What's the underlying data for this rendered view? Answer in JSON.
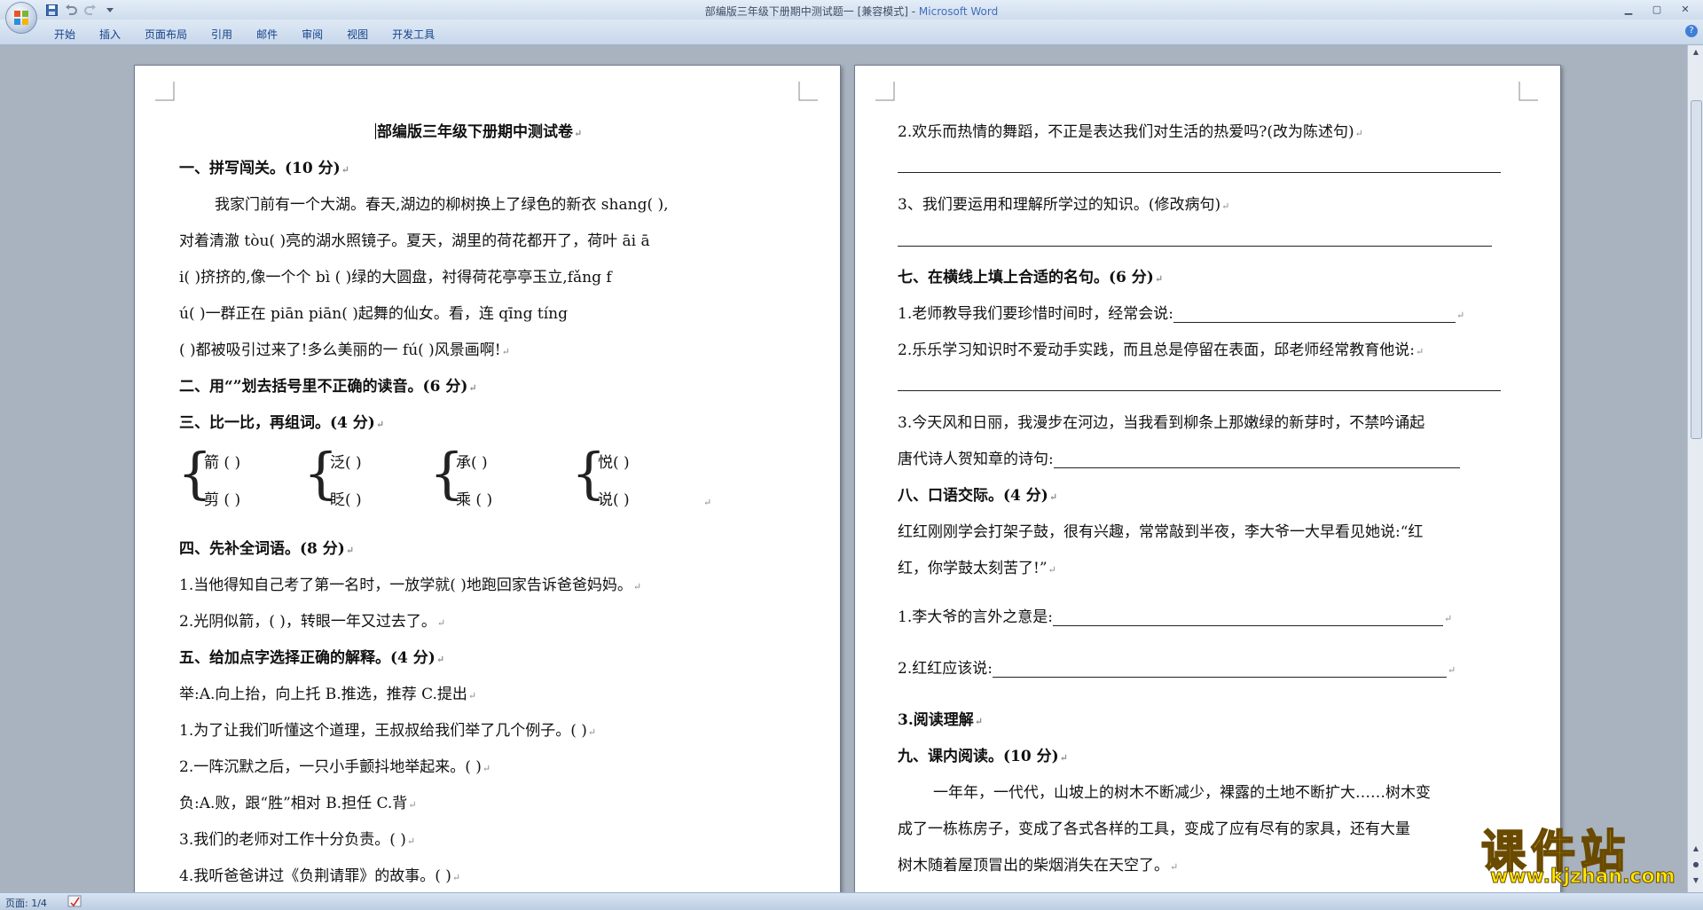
{
  "window": {
    "title_doc": "部编版三年级下册期中测试题一 [兼容模式] - ",
    "title_app": "Microsoft Word"
  },
  "ribbon": {
    "tabs": [
      "开始",
      "插入",
      "页面布局",
      "引用",
      "邮件",
      "审阅",
      "视图",
      "开发工具"
    ]
  },
  "status": {
    "page_label": "页面: 1/4"
  },
  "page1": {
    "doc_title": "部编版三年级下册期中测试卷",
    "s1_heading": "一、拼写闯关。(10 分)",
    "s1_p1": "我家门前有一个大湖。春天,湖边的柳树换上了绿色的新衣 shang(        ),",
    "s1_p2": "对着清澈 tòu(        )亮的湖水照镜子。夏天，湖里的荷花都开了，荷叶 āi  ā",
    "s1_p3": "i(      )挤挤的,像一个个 bì (       )绿的大圆盘，衬得荷花亭亭玉立,fǎng  f",
    "s1_p4": "ú(        )一群正在 piān piān(          )起舞的仙女。看，连 qīng tíng",
    "s1_p5": "(         )都被吸引过来了!多么美丽的一 fú(          )风景画啊!",
    "s2_heading": "二、用“”划去括号里不正确的读音。(6 分)",
    "s3_heading": "三、比一比，再组词。(4 分)",
    "s3_pairs": [
      {
        "top": "箭 (        )",
        "bottom": "剪 (        )"
      },
      {
        "top": "泛(         )",
        "bottom": "眨(         )"
      },
      {
        "top": "承(          )",
        "bottom": "乘 (          )"
      },
      {
        "top": "悦(         )",
        "bottom": "说(         )"
      }
    ],
    "s4_heading": "四、先补全词语。(8 分)",
    "s4_q1": "1.当他得知自己考了第一名时，一放学就(          )地跑回家告诉爸爸妈妈。",
    "s4_q2": "2.光阴似箭，(          )，转眼一年又过去了。",
    "s5_heading": "五、给加点字选择正确的解释。(4 分)",
    "s5_opt1": "举:A.向上抬，向上托 B.推选，推荐 C.提出",
    "s5_q1": "1.为了让我们听懂这个道理，王叔叔给我们举了几个例子。(          )",
    "s5_q2": "2.一阵沉默之后，一只小手颤抖地举起来。(           )",
    "s5_opt2": "负:A.败，跟“胜”相对 B.担任 C.背",
    "s5_q3": "3.我们的老师对工作十分负责。(          )",
    "s5_q4": "4.我听爸爸讲过《负荆请罪》的故事。(          )"
  },
  "page2": {
    "s6_q2": "2.欢乐而热情的舞蹈，不正是表达我们对生活的热爱吗?(改为陈述句)",
    "s6_q3": "3、我们要运用和理解所学过的知识。(修改病句)",
    "s7_heading": "七、在横线上填上合适的名句。(6 分)",
    "s7_q1": "1.老师教导我们要珍惜时间时，经常会说:",
    "s7_q2": "2.乐乐学习知识时不爱动手实践，而且总是停留在表面，邱老师经常教育他说:",
    "s7_q3a": "3.今天风和日丽，我漫步在河边，当我看到柳条上那嫩绿的新芽时，不禁吟诵起",
    "s7_q3b": "唐代诗人贺知章的诗句:",
    "s8_heading": "八、口语交际。(4 分)",
    "s8_p1": "红红刚刚学会打架子鼓，很有兴趣，常常敲到半夜，李大爷一大早看见她说:“红",
    "s8_p2": "红，你学鼓太刻苦了!”",
    "s8_q1": "1.李大爷的言外之意是:",
    "s8_q2": "2.红红应该说:",
    "s8_note": "3.阅读理解",
    "s9_heading": "九、课内阅读。(10 分)",
    "s9_p1": "一年年，一代代，山坡上的树木不断减少，裸露的土地不断扩大……树木变",
    "s9_p2": "成了一栋栋房子，变成了各式各样的工具，变成了应有尽有的家具，还有大量",
    "s9_p3": "树木随着屋顶冒出的柴烟消失在天空了。"
  },
  "watermark": {
    "cn": "课件站",
    "url": "www.kjzhan.com"
  }
}
